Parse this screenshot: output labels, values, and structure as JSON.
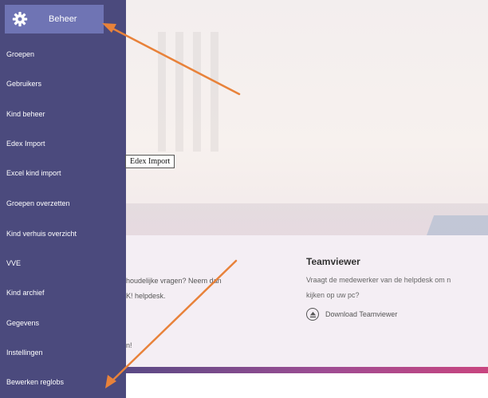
{
  "sidebar": {
    "header_label": "Beheer",
    "items": [
      {
        "label": "Groepen"
      },
      {
        "label": "Gebruikers"
      },
      {
        "label": "Kind beheer"
      },
      {
        "label": "Edex Import"
      },
      {
        "label": "Excel kind import"
      },
      {
        "label": "Groepen overzetten"
      },
      {
        "label": "Kind verhuis overzicht"
      },
      {
        "label": "VVE"
      },
      {
        "label": "Kind archief"
      },
      {
        "label": "Gegevens"
      },
      {
        "label": "Instellingen"
      },
      {
        "label": "Bewerken reglobs"
      }
    ]
  },
  "tooltip": {
    "text": "Edex Import"
  },
  "support": {
    "line1": "houdelijke vragen? Neem dan",
    "line2": "K! helpdesk.",
    "tail": "n!"
  },
  "teamviewer": {
    "title": "Teamviewer",
    "line1": "Vraagt de medewerker van de helpdesk om n",
    "line2": "kijken op uw pc?",
    "download_label": "Download Teamviewer"
  },
  "colors": {
    "sidebar_bg": "#4b4a7d",
    "header_bg": "#6f74b4",
    "arrow": "#e8823a"
  }
}
